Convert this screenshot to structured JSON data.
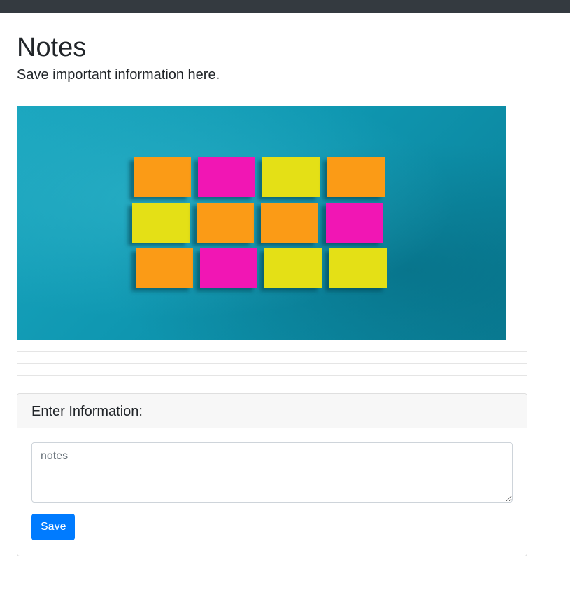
{
  "page": {
    "title": "Notes",
    "subtitle": "Save important information here."
  },
  "card": {
    "header": "Enter Information:",
    "notes_placeholder": "notes",
    "notes_value": "",
    "save_label": "Save"
  },
  "colors": {
    "navbar": "#343a40",
    "primary": "#007bff",
    "hero_background": "#0f97b1",
    "note_orange": "#fb9b12",
    "note_magenta": "#f114b4",
    "note_yellow": "#e4e013"
  },
  "hero": {
    "note_colors": [
      [
        "orange",
        "magenta",
        "yellow",
        "orange"
      ],
      [
        "yellow",
        "orange",
        "orange",
        "magenta"
      ],
      [
        "orange",
        "magenta",
        "yellow",
        "yellow"
      ]
    ]
  }
}
